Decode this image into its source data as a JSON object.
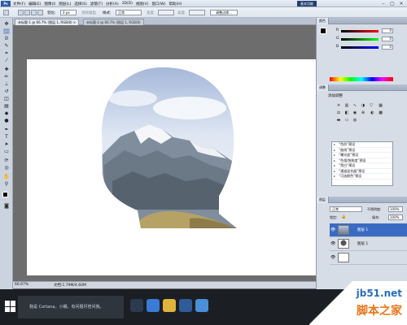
{
  "app": {
    "logo": "Ps"
  },
  "menu": {
    "items": [
      "文件(F)",
      "编辑(E)",
      "图像(I)",
      "图层(L)",
      "选择(S)",
      "滤镜(T)",
      "分析(A)",
      "3D(D)",
      "视图(V)",
      "窗口(W)",
      "帮助(H)"
    ],
    "essentials": "基本功能"
  },
  "options": {
    "feather_label": "羽化:",
    "feather_value": "0 px",
    "antialias_label": "消除锯齿",
    "style_label": "样式:",
    "style_value": "正常",
    "width_label": "宽度:",
    "height_label": "高度:",
    "refine_button": "调整边缘..."
  },
  "document": {
    "tab1": "未标题-1 @ 66.7% (图层 1, RGB/8) ×",
    "tab2": "未标题-2 @ 66.7% (图层 1, RGB/8)"
  },
  "status": {
    "zoom": "66.67%",
    "doc_size": "文档:1.79M/4.60M"
  },
  "color_panel": {
    "r_label": "R",
    "g_label": "G",
    "b_label": "B",
    "r_value": "0",
    "g_value": "0",
    "b_value": "0"
  },
  "adjustments": {
    "title": "添加调整",
    "presets": [
      "“色阶”预设",
      "“曲线”预设",
      "“曝光度”预设",
      "“色相/饱和度”预设",
      "“黑白”预设",
      "“通道混合器”预设",
      "“可选颜色”预设"
    ]
  },
  "layers": {
    "blend_mode": "正常",
    "opacity_label": "不透明度:",
    "opacity_value": "100%",
    "lock_label": "锁定:",
    "fill_label": "填充:",
    "fill_value": "100%",
    "rows": [
      {
        "name": "图层 1"
      },
      {
        "name": "图层 1"
      },
      {
        "name": ""
      }
    ]
  },
  "taskbar": {
    "search_placeholder": "我是 Cortana。小娜。有问题尽管问我。"
  },
  "watermark": {
    "site": "jb51.net",
    "cn": "脚本之家"
  }
}
